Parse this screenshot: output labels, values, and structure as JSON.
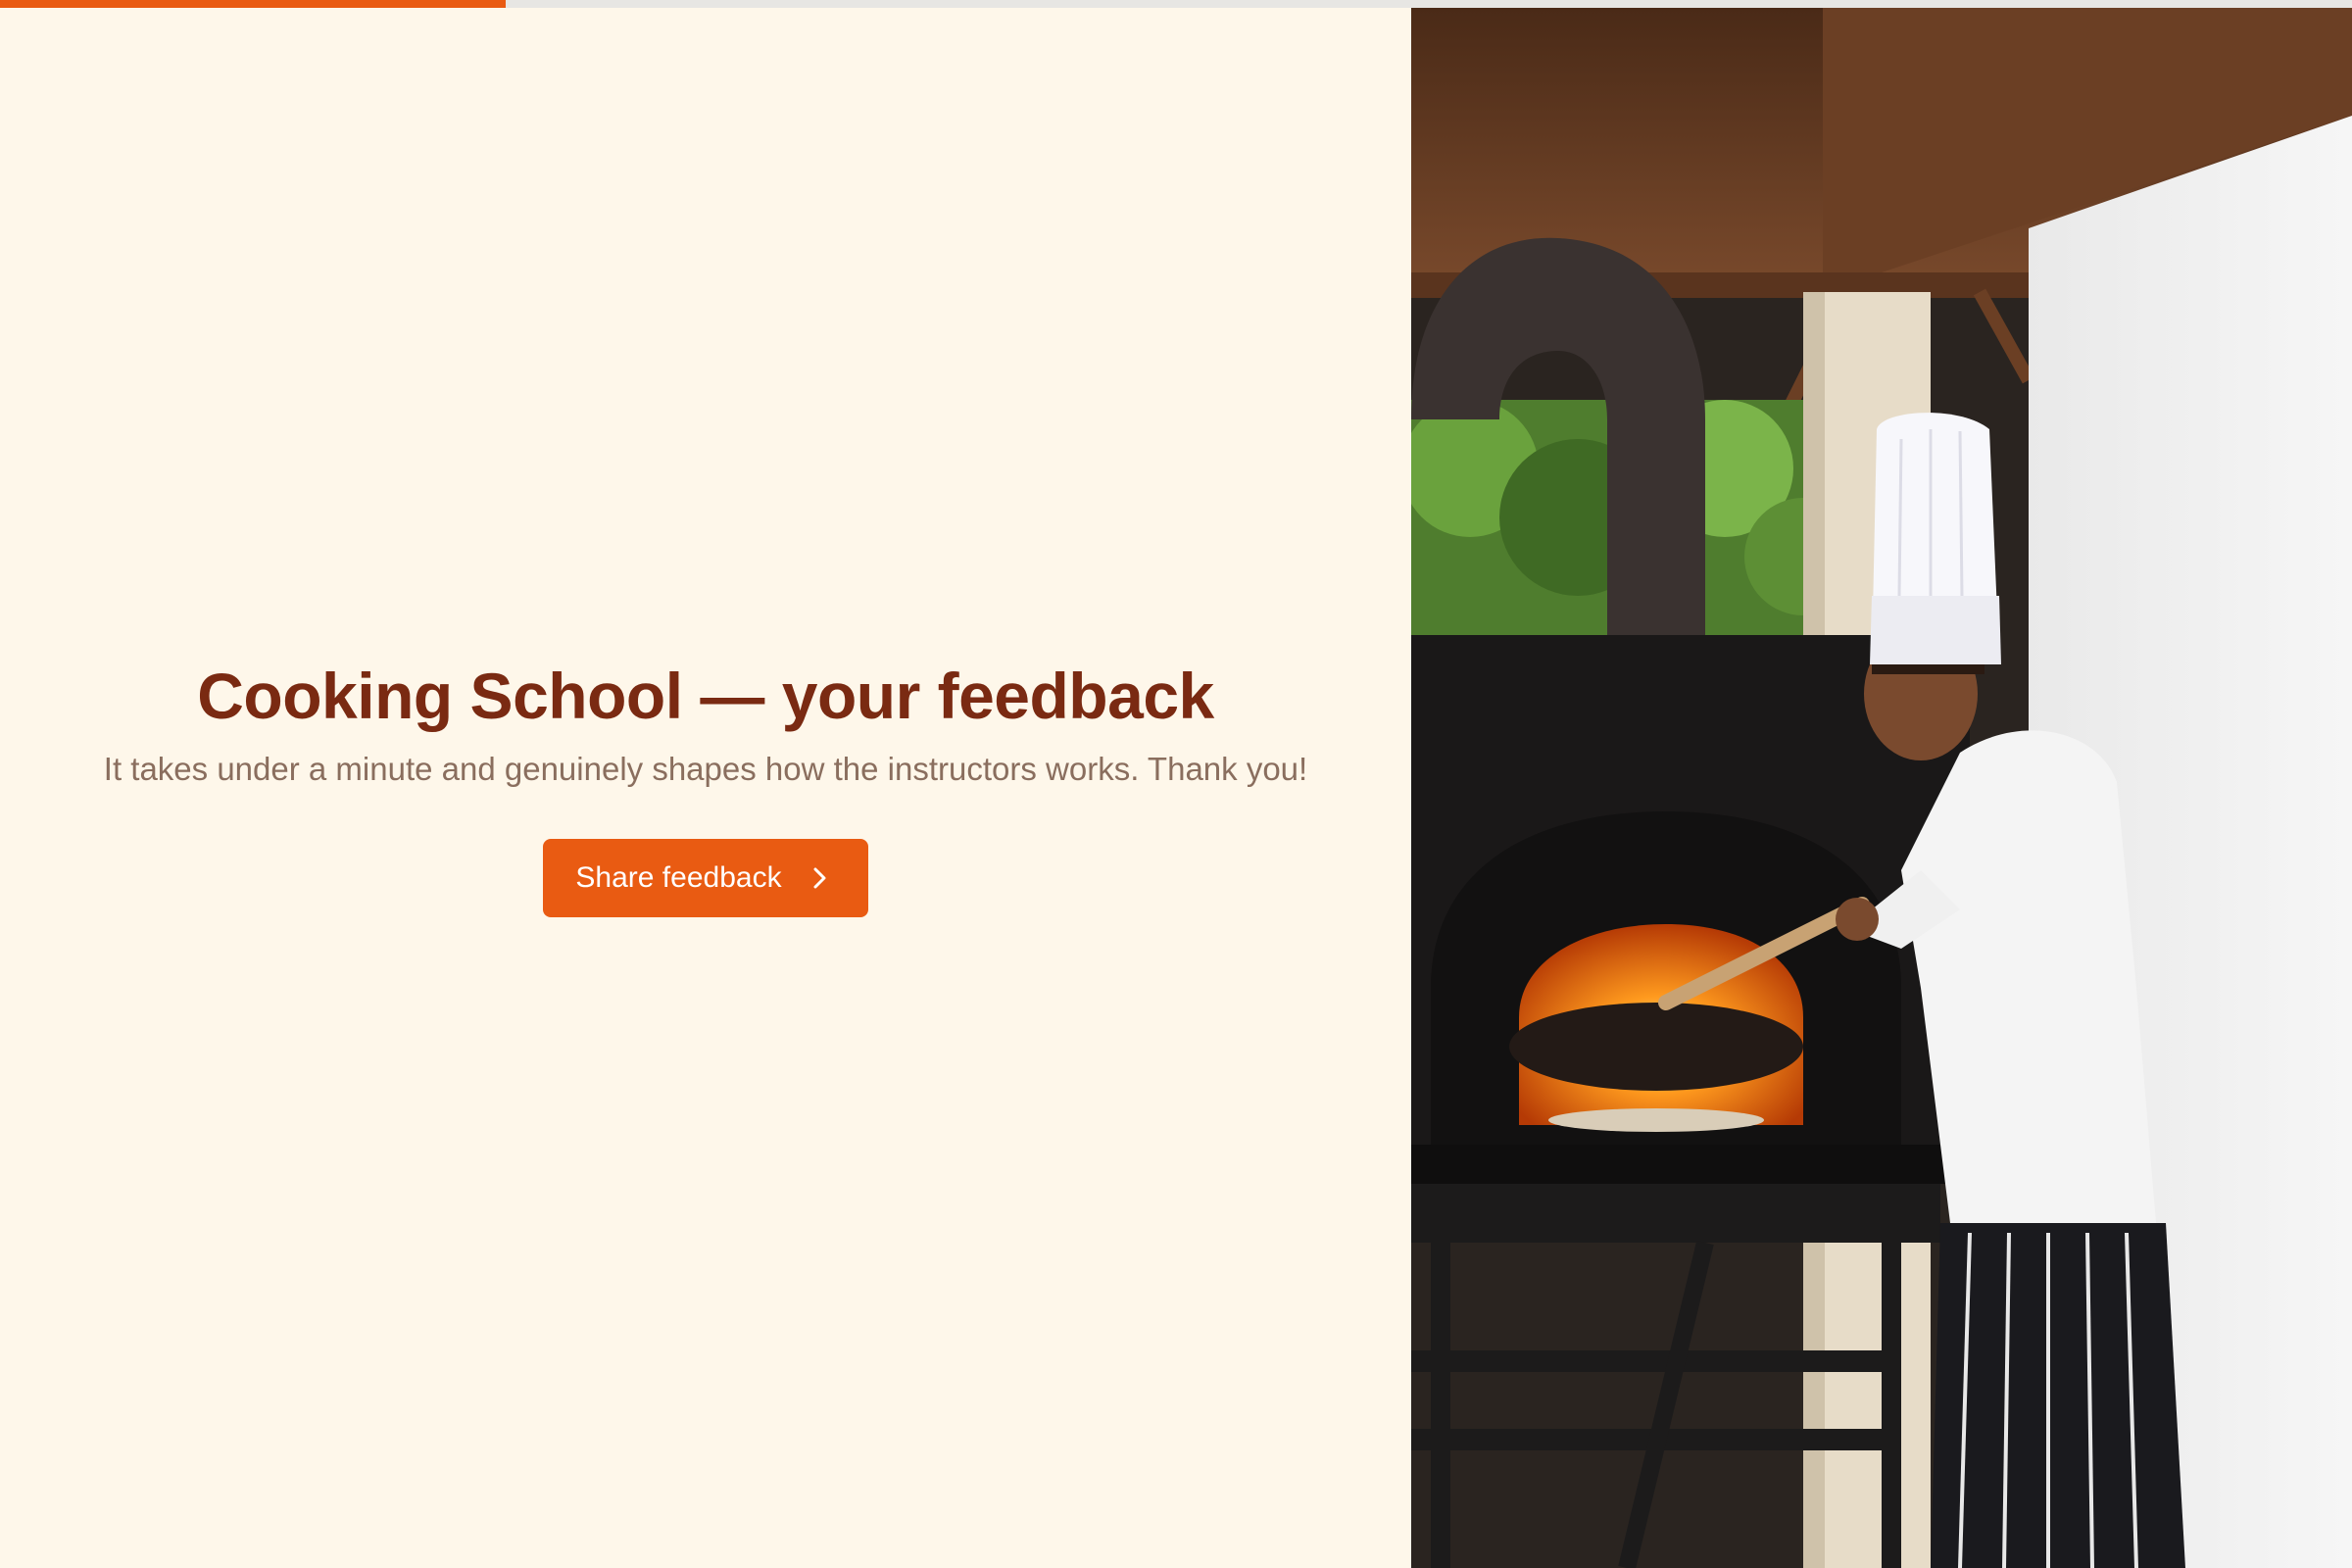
{
  "progress": {
    "value": 0.215,
    "fill_color": "#e95b12",
    "track_color": "#e7e6e3"
  },
  "intro": {
    "title": "Cooking School — your feedback",
    "subtitle": "It takes under a minute and genuinely shapes how the instructors works. Thank you!",
    "cta_label": "Share feedback",
    "cta_icon": "chevron-right-icon"
  },
  "colors": {
    "background": "#fef7ea",
    "title": "#7a2a12",
    "subtitle": "#8a6e5e",
    "accent": "#e95b12"
  }
}
